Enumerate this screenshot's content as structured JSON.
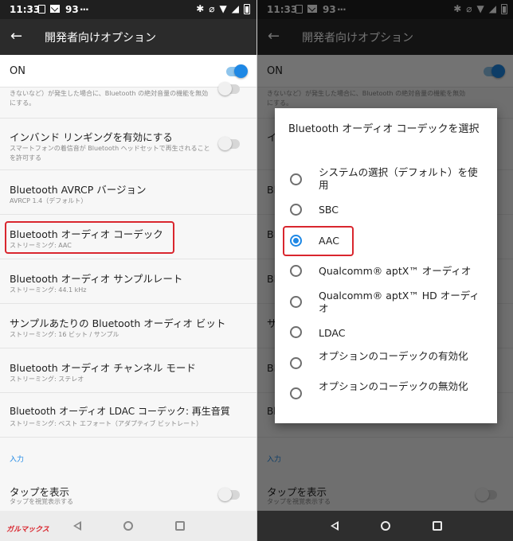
{
  "status": {
    "time": "11:33",
    "temp": "93",
    "dots": "...",
    "icons": [
      "bluetooth-icon",
      "mute-icon",
      "wifi-icon",
      "no-sim-icon",
      "battery-icon"
    ]
  },
  "header": {
    "back": "←",
    "title": "開発者向けオプション"
  },
  "on_bar": {
    "label": "ON",
    "enabled": true
  },
  "settings": {
    "partial_desc": "きないなど）が発生した場合に、Bluetooth の絶対音量の機能を無効にする。",
    "inband": {
      "title": "インバンド リンギングを有効にする",
      "desc": "スマートフォンの着信音が Bluetooth ヘッドセットで再生されることを許可する"
    },
    "avrcp": {
      "title": "Bluetooth AVRCP バージョン",
      "desc": "AVRCP 1.4（デフォルト）"
    },
    "codec": {
      "title": "Bluetooth オーディオ コーデック",
      "desc": "ストリーミング: AAC"
    },
    "sample_rate": {
      "title": "Bluetooth オーディオ サンプルレート",
      "desc": "ストリーミング: 44.1 kHz"
    },
    "bits": {
      "title": "サンプルあたりの Bluetooth オーディオ ビット",
      "desc": "ストリーミング: 16 ビット / サンプル"
    },
    "channel": {
      "title": "Bluetooth オーディオ チャンネル モード",
      "desc": "ストリーミング: ステレオ"
    },
    "ldac": {
      "title": "Bluetooth オーディオ LDAC コーデック: 再生音質",
      "desc": "ストリーミング: ベスト エフォート（アダプティブ ビットレート）"
    },
    "section_input": "入力",
    "tap": {
      "title": "タップを表示",
      "desc": "タップを視覚表示する"
    }
  },
  "dialog": {
    "title": "Bluetooth オーディオ コーデックを選択",
    "selected_index": 2,
    "options": [
      "システムの選択（デフォルト）を使用",
      "SBC",
      "AAC",
      "Qualcomm® aptX™ オーディオ",
      "Qualcomm® aptX™ HD オーディオ",
      "LDAC",
      "オプションのコーデックの有効化",
      "オプションのコーデックの無効化"
    ]
  },
  "watermark": "ガルマックス",
  "colors": {
    "accent": "#1e88e5",
    "highlight": "#d9262e",
    "appbar": "#2b2b2b"
  }
}
